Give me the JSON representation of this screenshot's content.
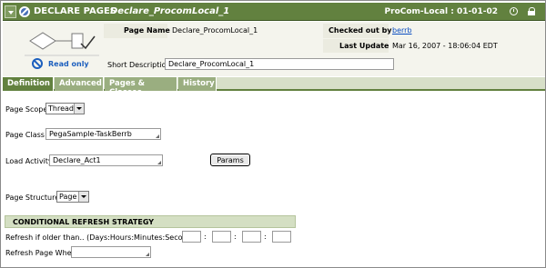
{
  "titlebar": {
    "rule_type": "DECLARE PAGES",
    "rule_name": "Declare_ProcomLocal_1",
    "version": "ProCom-Local : 01-01-02"
  },
  "header": {
    "page_name_label": "Page Name",
    "page_name_value": "Declare_ProcomLocal_1",
    "checked_out_label": "Checked out by",
    "checked_out_value": "berrb",
    "last_update_label": "Last Update",
    "last_update_value": "Mar 16, 2007 - 18:06:04 EDT",
    "read_only_label": "Read only",
    "short_desc_label": "Short Description",
    "short_desc_value": "Declare_ProcomLocal_1"
  },
  "tabs": [
    {
      "label": "Definition",
      "active": true
    },
    {
      "label": "Advanced",
      "active": false
    },
    {
      "label": "Pages & Classes",
      "active": false
    },
    {
      "label": "History",
      "active": false
    }
  ],
  "form": {
    "page_scope_label": "Page Scope",
    "page_scope_value": "Thread",
    "page_class_label": "Page Class",
    "page_class_value": "PegaSample-TaskBerrb",
    "load_activity_label": "Load Activity",
    "load_activity_value": "Declare_Act1",
    "params_label": "Params",
    "page_structure_label": "Page Structure",
    "page_structure_value": "Page"
  },
  "refresh": {
    "section_title": "CONDITIONAL REFRESH STRATEGY",
    "older_than_label": "Refresh if older than.. (Days:Hours:Minutes:Seconds)",
    "refresh_when_label": "Refresh Page When",
    "separators": [
      ":",
      ":",
      ":"
    ]
  }
}
